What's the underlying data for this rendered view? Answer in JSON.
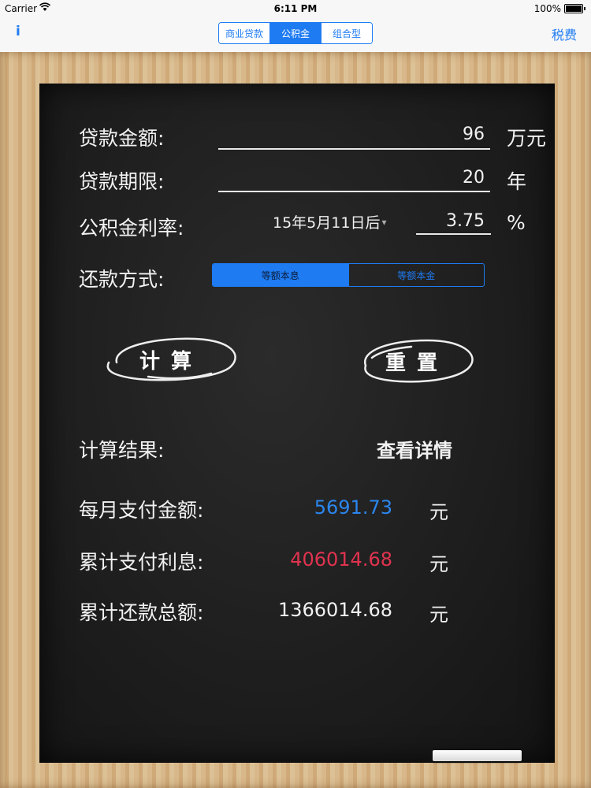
{
  "status": {
    "carrier": "Carrier",
    "time": "6:11 PM",
    "battery": "100%"
  },
  "nav": {
    "info": "i",
    "right": "税费",
    "tabs": [
      "商业贷款",
      "公积金",
      "组合型"
    ],
    "active_tab": 1
  },
  "form": {
    "amount_label": "贷款金额:",
    "amount_value": "96",
    "amount_unit": "万元",
    "term_label": "贷款期限:",
    "term_value": "20",
    "term_unit": "年",
    "rate_label": "公积金利率:",
    "rate_date": "15年5月11日后",
    "rate_value": "3.75",
    "rate_unit": "%",
    "method_label": "还款方式:",
    "methods": [
      "等额本息",
      "等额本金"
    ],
    "active_method": 0
  },
  "buttons": {
    "calc": "计算",
    "reset": "重置"
  },
  "results": {
    "label": "计算结果:",
    "details": "查看详情",
    "monthly_label": "每月支付金额:",
    "monthly_value": "5691.73",
    "monthly_unit": "元",
    "interest_label": "累计支付利息:",
    "interest_value": "406014.68",
    "interest_unit": "元",
    "total_label": "累计还款总额:",
    "total_value": "1366014.68",
    "total_unit": "元"
  },
  "colors": {
    "accent": "#1e7bf2",
    "monthly": "#2b86ee",
    "interest": "#e0334f",
    "chalk": "#f2f2f2"
  }
}
